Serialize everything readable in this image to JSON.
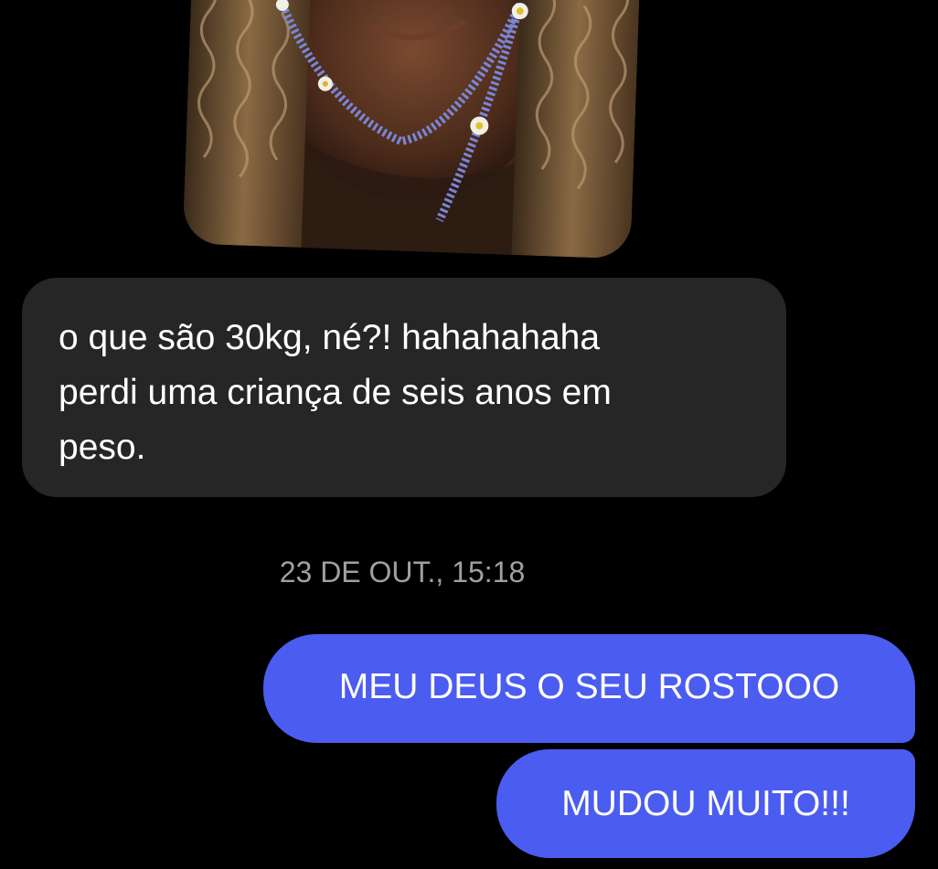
{
  "conversation": {
    "photo": {
      "icon": "shared-photo-image"
    },
    "received_message": {
      "line1": "o que são 30kg, né?! hahahahaha",
      "line2": "perdi uma criança de seis anos em",
      "line3": "peso."
    },
    "timestamp": "23 DE OUT., 15:18",
    "sent_messages": [
      {
        "text": "MEU DEUS O SEU ROSTOOO"
      },
      {
        "text": "MUDOU MUITO!!!"
      }
    ]
  },
  "colors": {
    "background": "#000000",
    "received_bubble": "#262626",
    "sent_bubble": "#4b5cf0",
    "timestamp_text": "#a0a0a4"
  }
}
